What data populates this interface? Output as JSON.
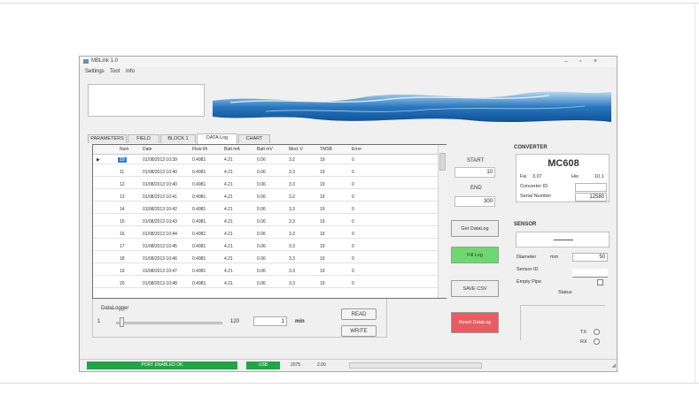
{
  "window": {
    "title": "MBLink 1.0"
  },
  "menu": [
    "Settings",
    "Tool",
    "Info"
  ],
  "tabs": [
    {
      "label": "PARAMETERS",
      "active": false
    },
    {
      "label": "FIELD",
      "active": false
    },
    {
      "label": "BLOCK 1",
      "active": false
    },
    {
      "label": "DATA Log",
      "active": true
    },
    {
      "label": "CHART",
      "active": false
    }
  ],
  "grid": {
    "columns": [
      "Num",
      "Date",
      "Flow l/h",
      "Batt mA",
      "Batt mV",
      "Mod. V",
      "TMSB",
      "Error"
    ],
    "rows": [
      [
        "10",
        "01/08/2013 10:39",
        "0.4981",
        "4.21",
        "0.06",
        "3.2",
        "19",
        "0"
      ],
      [
        "11",
        "01/08/2013 10:40",
        "0.4981",
        "4.21",
        "0.06",
        "3.3",
        "19",
        "0"
      ],
      [
        "12",
        "01/08/2013 10:40",
        "0.4981",
        "4.21",
        "0.06",
        "3.3",
        "19",
        "0"
      ],
      [
        "13",
        "01/08/2013 10:41",
        "0.4981",
        "4.21",
        "0.06",
        "3.2",
        "19",
        "0"
      ],
      [
        "14",
        "01/08/2013 10:42",
        "0.4981",
        "4.21",
        "0.06",
        "3.3",
        "19",
        "0"
      ],
      [
        "15",
        "01/08/2013 10:43",
        "0.4981",
        "4.21",
        "0.06",
        "3.3",
        "19",
        "0"
      ],
      [
        "16",
        "01/08/2013 10:44",
        "0.4981",
        "4.21",
        "0.06",
        "3.3",
        "19",
        "0"
      ],
      [
        "17",
        "01/08/2013 10:45",
        "0.4981",
        "4.21",
        "0.06",
        "3.3",
        "19",
        "0"
      ],
      [
        "18",
        "01/08/2013 10:46",
        "0.4981",
        "4.21",
        "0.06",
        "3.3",
        "19",
        "0"
      ],
      [
        "19",
        "01/08/2013 10:47",
        "0.4981",
        "4.21",
        "0.06",
        "3.3",
        "19",
        "0"
      ],
      [
        "20",
        "01/08/2013 10:48",
        "0.4981",
        "4.21",
        "0.06",
        "3.3",
        "19",
        "0"
      ]
    ]
  },
  "datalogger": {
    "title": "DataLogger",
    "slider_min": "1",
    "slider_max": "120",
    "interval_value": "1",
    "interval_unit": "min",
    "read_label": "READ",
    "write_label": "WRITE"
  },
  "log_controls": {
    "start_label": "START",
    "start_value": "10",
    "end_label": "END",
    "end_value": "300",
    "get_datalog_label": "Get DataLog",
    "fill_log_label": "Fill Log",
    "save_csv_label": "SAVE CSV",
    "reset_datalog_label": "Reset DataLog"
  },
  "converter": {
    "title": "CONVERTER",
    "model": "MC608",
    "fw_label": "Fw",
    "fw_value": "3.07",
    "hw_label": "Hw",
    "hw_value": "10.1",
    "converter_id_label": "Converter ID",
    "converter_id_value": "",
    "serial_label": "Serial Number",
    "serial_value": "12580"
  },
  "sensor": {
    "title": "SENSOR",
    "display": "",
    "diameter_label": "Diameter",
    "diameter_unit": "mm",
    "diameter_value": "50",
    "sensor_id_label": "Sensor ID",
    "sensor_id_value": "",
    "empty_pipe_label": "Empty Pipe",
    "status_label": "Status"
  },
  "radios": [
    {
      "label": "TX"
    },
    {
      "label": "RX"
    }
  ],
  "status": {
    "port_status": "PORT ENABLED OK",
    "mode": "USB",
    "baud": "2075",
    "value": "2.00"
  },
  "colors": {
    "green": "#22a447",
    "green_button": "#6fd76f",
    "red_button": "#ea5b63",
    "selection": "#3a7fd5"
  },
  "icons": [
    "app-icon",
    "minimize-icon",
    "maximize-icon",
    "close-icon",
    "row-pointer-icon"
  ]
}
